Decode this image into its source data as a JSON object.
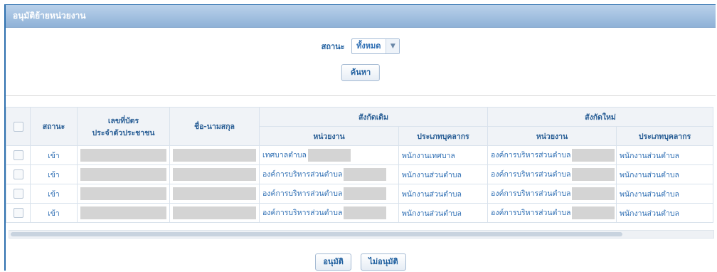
{
  "panel": {
    "title": "อนุมัติย้ายหน่วยงาน"
  },
  "filter": {
    "status_label": "สถานะ",
    "status_value": "ทั้งหมด",
    "search_label": "ค้นหา"
  },
  "table": {
    "headers": {
      "status": "สถานะ",
      "id_card_line1": "เลขที่บัตร",
      "id_card_line2": "ประจำตัวประชาชน",
      "name": "ชื่อ-นามสกุล",
      "old_group": "สังกัดเดิม",
      "new_group": "สังกัดใหม่",
      "unit": "หน่วยงาน",
      "personnel_type": "ประเภทบุคลากร"
    },
    "rows": [
      {
        "status": "เข้า",
        "old_unit": "เทศบาลตำบล",
        "old_type": "พนักงานเทศบาล",
        "new_unit": "องค์การบริหารส่วนตำบล",
        "new_type": "พนักงานส่วนตำบล"
      },
      {
        "status": "เข้า",
        "old_unit": "องค์การบริหารส่วนตำบล",
        "old_type": "พนักงานส่วนตำบล",
        "new_unit": "องค์การบริหารส่วนตำบล",
        "new_type": "พนักงานส่วนตำบล"
      },
      {
        "status": "เข้า",
        "old_unit": "องค์การบริหารส่วนตำบล",
        "old_type": "พนักงานส่วนตำบล",
        "new_unit": "องค์การบริหารส่วนตำบล",
        "new_type": "พนักงานส่วนตำบล"
      },
      {
        "status": "เข้า",
        "old_unit": "องค์การบริหารส่วนตำบล",
        "old_type": "พนักงานส่วนตำบล",
        "new_unit": "องค์การบริหารส่วนตำบล",
        "new_type": "พนักงานส่วนตำบล"
      }
    ]
  },
  "actions": {
    "approve_label": "อนุมัติ",
    "reject_label": "ไม่อนุมัติ"
  }
}
